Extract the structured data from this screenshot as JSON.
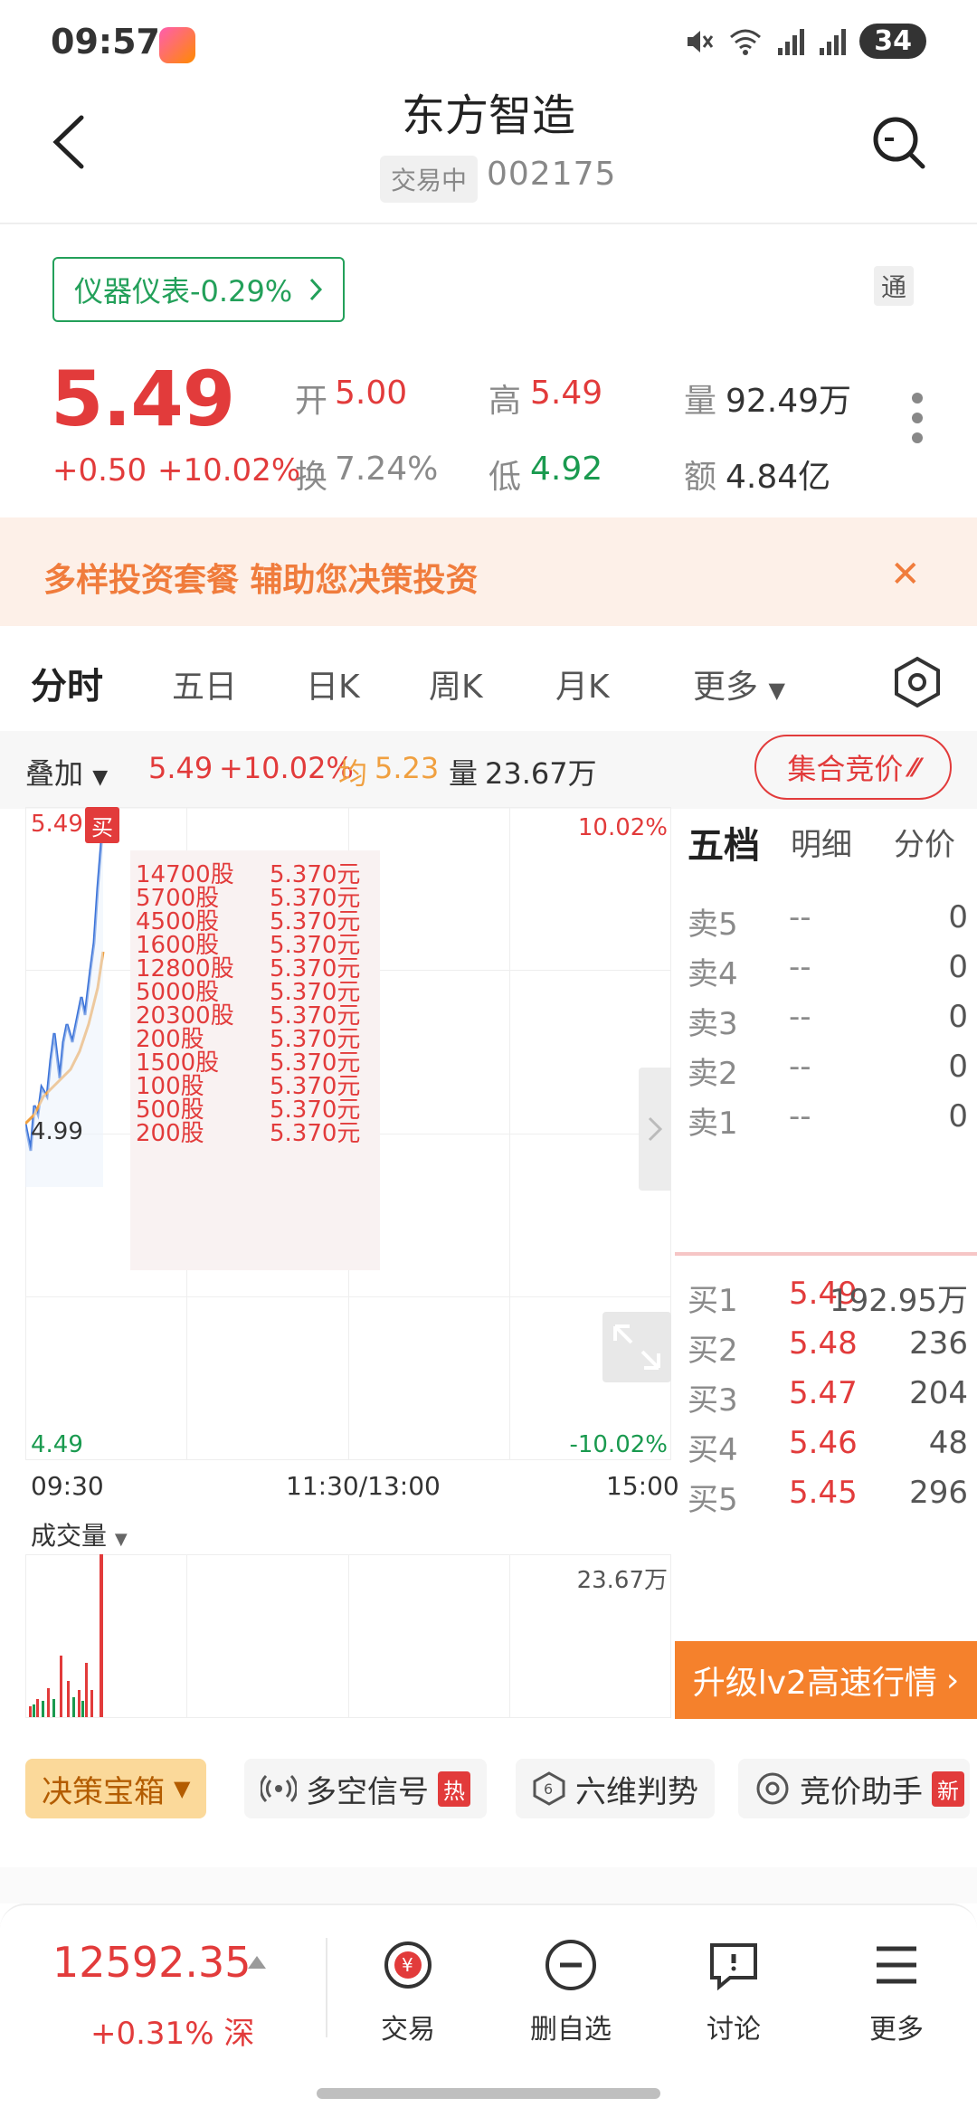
{
  "status_bar": {
    "time": "09:57",
    "battery": "34"
  },
  "header": {
    "title": "东方智造",
    "status_tag": "交易中",
    "code": "002175"
  },
  "sector": {
    "label": "仪器仪表-0.29%",
    "tong_badge": "通"
  },
  "quote": {
    "price": "5.49",
    "change": "+0.50",
    "change_pct": "+10.02%",
    "open_label": "开",
    "open": "5.00",
    "high_label": "高",
    "high": "5.49",
    "volume_label": "量",
    "volume": "92.49万",
    "turnover_label": "换",
    "turnover": "7.24%",
    "low_label": "低",
    "low": "4.92",
    "amount_label": "额",
    "amount": "4.84亿"
  },
  "promo": {
    "text": "多样投资套餐 辅助您决策投资",
    "close": "✕"
  },
  "chart_tabs": [
    "分时",
    "五日",
    "日K",
    "周K",
    "月K",
    "更多"
  ],
  "overlay": {
    "label": "叠加",
    "price": "5.49",
    "pct": "+10.02%",
    "avg_label": "均",
    "avg": "5.23",
    "vol_label": "量",
    "vol": "23.67万",
    "auction_button": "集合竞价"
  },
  "chart": {
    "y_top": "5.49",
    "y_mid": "4.99",
    "y_bottom": "4.49",
    "pct_top": "10.02%",
    "pct_bottom": "-10.02%",
    "buy_marker": "买",
    "times": [
      "09:30",
      "11:30/13:00",
      "15:00"
    ]
  },
  "trades": [
    {
      "qty": "14700股",
      "price": "5.370元"
    },
    {
      "qty": "5700股",
      "price": "5.370元"
    },
    {
      "qty": "4500股",
      "price": "5.370元"
    },
    {
      "qty": "1600股",
      "price": "5.370元"
    },
    {
      "qty": "12800股",
      "price": "5.370元"
    },
    {
      "qty": "5000股",
      "price": "5.370元"
    },
    {
      "qty": "20300股",
      "price": "5.370元"
    },
    {
      "qty": "200股",
      "price": "5.370元"
    },
    {
      "qty": "1500股",
      "price": "5.370元"
    },
    {
      "qty": "100股",
      "price": "5.370元"
    },
    {
      "qty": "500股",
      "price": "5.370元"
    },
    {
      "qty": "200股",
      "price": "5.370元"
    }
  ],
  "volume_chart": {
    "label": "成交量",
    "max": "23.67万"
  },
  "order_book": {
    "tabs": [
      "五档",
      "明细",
      "分价"
    ],
    "asks": [
      {
        "label": "卖5",
        "price": "--",
        "vol": "0"
      },
      {
        "label": "卖4",
        "price": "--",
        "vol": "0"
      },
      {
        "label": "卖3",
        "price": "--",
        "vol": "0"
      },
      {
        "label": "卖2",
        "price": "--",
        "vol": "0"
      },
      {
        "label": "卖1",
        "price": "--",
        "vol": "0"
      }
    ],
    "bids": [
      {
        "label": "买1",
        "price": "5.49",
        "vol": "192.95万"
      },
      {
        "label": "买2",
        "price": "5.48",
        "vol": "236"
      },
      {
        "label": "买3",
        "price": "5.47",
        "vol": "204"
      },
      {
        "label": "买4",
        "price": "5.46",
        "vol": "48"
      },
      {
        "label": "买5",
        "price": "5.45",
        "vol": "296"
      }
    ],
    "upgrade_button": "升级lv2高速行情"
  },
  "tools": [
    {
      "label": "决策宝箱"
    },
    {
      "label": "多空信号",
      "badge": "热"
    },
    {
      "label": "六维判势"
    },
    {
      "label": "竞价助手",
      "badge": "新"
    }
  ],
  "bottom_nav": {
    "index_value": "12592.35",
    "index_change": "+0.31%",
    "index_market": "深",
    "items": [
      "交易",
      "删自选",
      "讨论",
      "更多"
    ]
  },
  "colors": {
    "up": "#e23b3b",
    "down": "#1a9a4f",
    "accent": "#f5812c",
    "price_line": "#3b73d9",
    "avg_line": "#f0a040"
  }
}
